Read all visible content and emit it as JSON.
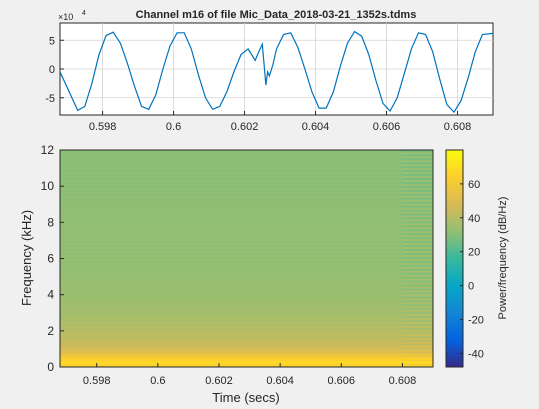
{
  "figure": {
    "title": "Channel m16 of file Mic_Data_2018-03-21_1352s.tdms",
    "background": "#f0f0f0"
  },
  "chart_data": [
    {
      "type": "line",
      "title": "Channel m16 of file Mic_Data_2018-03-21_1352s.tdms",
      "xlabel": "",
      "ylabel": "",
      "exponent_label": "×10",
      "exponent_power": "4",
      "xlim": [
        0.5968,
        0.609
      ],
      "ylim": [
        -8,
        8
      ],
      "scale": 10000,
      "x_ticks": [
        0.598,
        0.6,
        0.602,
        0.604,
        0.606,
        0.608
      ],
      "x_tick_labels": [
        "0.598",
        "0.6",
        "0.602",
        "0.604",
        "0.606",
        "0.608"
      ],
      "y_ticks": [
        5,
        0,
        -5
      ],
      "y_tick_labels": [
        "5",
        "0",
        "-5"
      ],
      "grid": true,
      "series": [
        {
          "color": "#0072bd",
          "x": [
            0.5968,
            0.5971,
            0.5973,
            0.5975,
            0.5977,
            0.5979,
            0.5981,
            0.5983,
            0.5985,
            0.5987,
            0.5989,
            0.5991,
            0.5993,
            0.5995,
            0.5997,
            0.5999,
            0.6001,
            0.6003,
            0.6005,
            0.6007,
            0.6009,
            0.6011,
            0.6013,
            0.6015,
            0.6017,
            0.6019,
            0.6021,
            0.6023,
            0.6024,
            0.6025,
            0.6026,
            0.60265,
            0.6027,
            0.6028,
            0.6029,
            0.6031,
            0.6033,
            0.6035,
            0.6037,
            0.6039,
            0.6041,
            0.6043,
            0.6045,
            0.6047,
            0.6049,
            0.6051,
            0.6053,
            0.6055,
            0.6057,
            0.6059,
            0.6061,
            0.6063,
            0.6065,
            0.6067,
            0.6069,
            0.6071,
            0.6073,
            0.6075,
            0.6077,
            0.6079,
            0.6081,
            0.6083,
            0.6085,
            0.6087,
            0.609
          ],
          "y": [
            -0.5,
            -4.5,
            -7.2,
            -6.5,
            -2.5,
            2.5,
            5.8,
            6.4,
            4.5,
            1.0,
            -3.0,
            -6.5,
            -7.0,
            -4.5,
            0.0,
            4.0,
            6.3,
            6.3,
            3.5,
            -1.0,
            -5.0,
            -7.0,
            -6.5,
            -4.0,
            -0.5,
            2.5,
            3.5,
            1.5,
            3.0,
            4.3,
            -2.8,
            -0.5,
            -1.2,
            0.8,
            3.5,
            6.0,
            6.3,
            3.8,
            0.0,
            -4.0,
            -6.8,
            -6.8,
            -4.0,
            0.5,
            4.5,
            6.5,
            5.7,
            2.5,
            -2.0,
            -6.0,
            -7.3,
            -5.0,
            -0.8,
            3.5,
            6.3,
            6.0,
            3.0,
            -1.8,
            -6.2,
            -7.5,
            -5.5,
            -1.5,
            3.0,
            6.0,
            6.2
          ]
        }
      ]
    },
    {
      "type": "heatmap",
      "title": "",
      "xlabel": "Time (secs)",
      "ylabel": "Frequency (kHz)",
      "colorbar_label": "Power/frequency (dB/Hz)",
      "xlim": [
        0.5968,
        0.609
      ],
      "ylim": [
        0,
        12
      ],
      "x_ticks": [
        0.598,
        0.6,
        0.602,
        0.604,
        0.606,
        0.608
      ],
      "x_tick_labels": [
        "0.598",
        "0.6",
        "0.602",
        "0.604",
        "0.606",
        "0.608"
      ],
      "y_ticks": [
        0,
        2,
        4,
        6,
        8,
        10,
        12
      ],
      "y_tick_labels": [
        "0",
        "2",
        "4",
        "6",
        "8",
        "10",
        "12"
      ],
      "colorbar_range": [
        -48,
        80
      ],
      "colorbar_ticks": [
        60,
        40,
        20,
        0,
        -20,
        -40
      ],
      "colorbar_tick_labels": [
        "60",
        "40",
        "20",
        "0",
        "-20",
        "-40"
      ],
      "colormap": "parula",
      "time_edges": [
        0.5968,
        0.608,
        0.609
      ],
      "freq_profile_khz": [
        0,
        0.2,
        0.4,
        0.6,
        0.8,
        1.0,
        1.5,
        2.0,
        2.5,
        3.0,
        4.0,
        5.0,
        6.0,
        8.0,
        10.0,
        12.0
      ],
      "freq_profile_db": [
        62,
        68,
        66,
        60,
        52,
        47,
        43,
        40,
        38,
        36,
        34,
        33,
        32,
        32,
        31,
        31
      ]
    }
  ]
}
